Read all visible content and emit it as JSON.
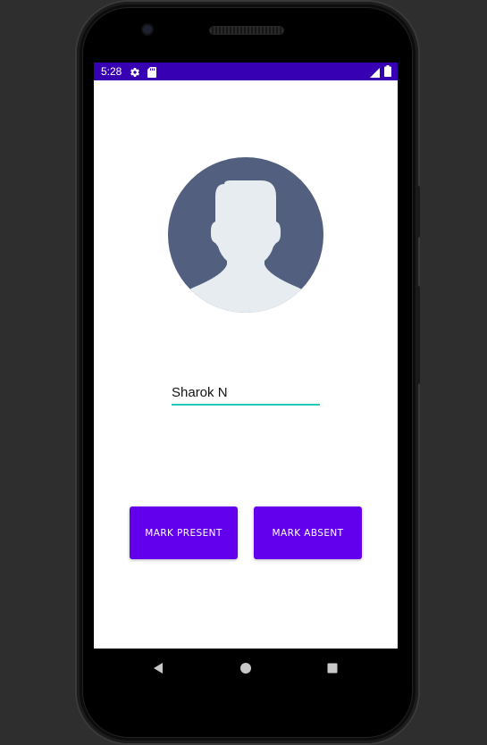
{
  "status_bar": {
    "time": "5:28",
    "icons": [
      "settings-icon",
      "sd-card-icon",
      "signal-icon",
      "battery-icon"
    ],
    "background": "#3700b3"
  },
  "profile": {
    "avatar_icon": "person-avatar-icon",
    "avatar_bg": "#525f7f",
    "avatar_fg": "#e6ecef"
  },
  "name_input": {
    "value": "Sharok N",
    "underline_color": "#1fcbb4"
  },
  "actions": {
    "mark_present_label": "MARK PRESENT",
    "mark_absent_label": "MARK ABSENT",
    "button_color": "#6200ee"
  },
  "navigation": {
    "back_icon": "back-triangle-icon",
    "home_icon": "home-circle-icon",
    "recents_icon": "recents-square-icon"
  }
}
